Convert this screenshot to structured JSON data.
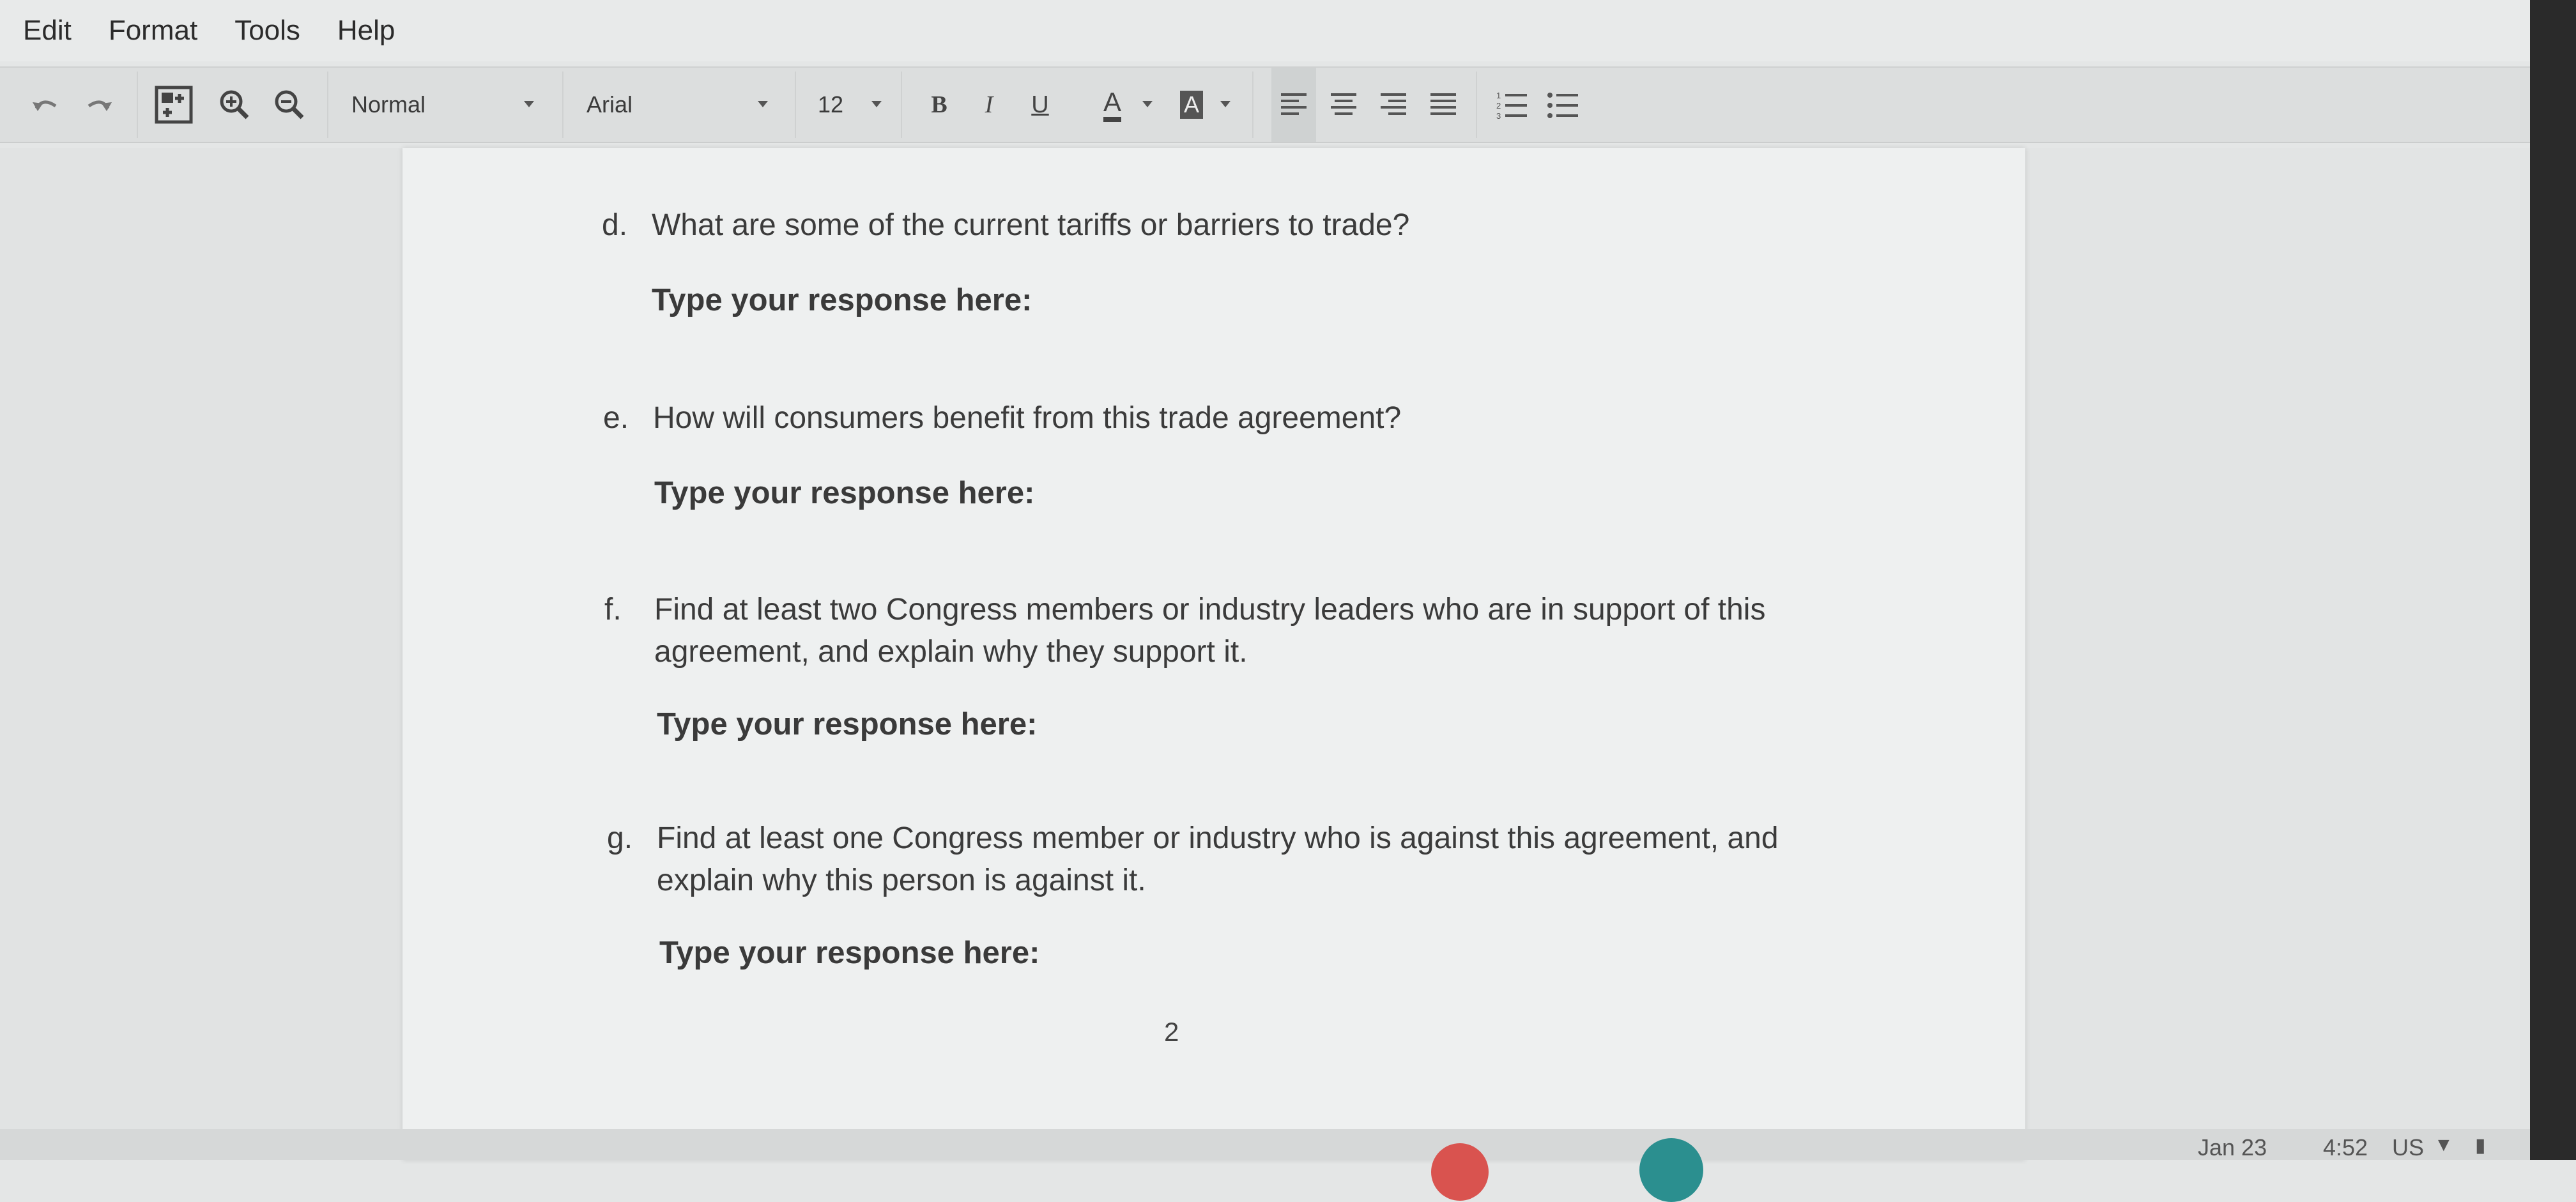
{
  "menubar": {
    "items": [
      "Edit",
      "Format",
      "Tools",
      "Help"
    ]
  },
  "toolbar": {
    "style_value": "Normal",
    "font_value": "Arial",
    "size_value": "12",
    "bold_label": "B",
    "italic_label": "I",
    "underline_label": "U",
    "text_color_label": "A",
    "highlight_label": "A",
    "icons": [
      "undo-icon",
      "redo-icon",
      "insert-table-icon",
      "zoom-in-icon",
      "zoom-out-icon",
      "align-left-icon",
      "align-center-icon",
      "align-right-icon",
      "justify-icon",
      "numbered-list-icon",
      "bulleted-list-icon"
    ]
  },
  "document": {
    "questions": [
      {
        "label": "d.",
        "text": "What are some of the current tariffs or barriers to trade?"
      },
      {
        "label": "e.",
        "text": "How will consumers benefit from this trade agreement?"
      },
      {
        "label": "f.",
        "text": "Find at least two Congress members or industry leaders who are in support of this agreement, and explain why they support it."
      },
      {
        "label": "g.",
        "text": "Find at least one Congress member or industry who is against this agreement, and explain why this person is against it."
      }
    ],
    "response_prompt": "Type your response here:",
    "page_number": "2"
  },
  "system_tray": {
    "date": "Jan 23",
    "time": "4:52",
    "locale": "US"
  },
  "colors": {
    "page_bg": "#eef0f0",
    "toolbar_bg": "#dcdede",
    "accent_red": "#d9534f",
    "accent_teal": "#2b8f8f"
  }
}
